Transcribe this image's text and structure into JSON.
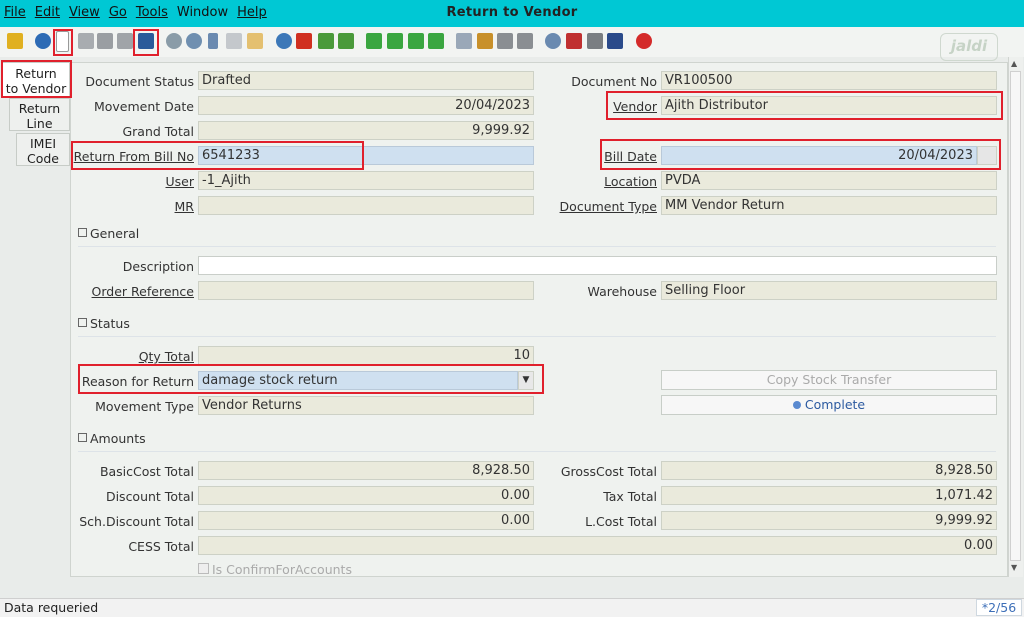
{
  "window": {
    "title": "Return to Vendor"
  },
  "menu": {
    "file": "File",
    "edit": "Edit",
    "view": "View",
    "go": "Go",
    "tools": "Tools",
    "window": "Window",
    "help": "Help"
  },
  "logo": "jaldi",
  "tabs": {
    "return_to_vendor_1": "Return",
    "return_to_vendor_2": "to Vendor",
    "return_line_1": "Return",
    "return_line_2": "Line",
    "imei_1": "IMEI",
    "imei_2": "Code"
  },
  "header": {
    "document_status_label": "Document Status",
    "document_status": "Drafted",
    "movement_date_label": "Movement Date",
    "movement_date": "20/04/2023",
    "grand_total_label": "Grand Total",
    "grand_total": "9,999.92",
    "return_from_bill_no_label": "Return From Bill No",
    "return_from_bill_no": "6541233",
    "user_label": "User",
    "user": "-1_Ajith",
    "mr_label": "MR",
    "mr": "",
    "document_no_label": "Document No",
    "document_no": "VR100500",
    "vendor_label": "Vendor",
    "vendor": "Ajith Distributor",
    "bill_date_label": "Bill Date",
    "bill_date": "20/04/2023",
    "location_label": "Location",
    "location": "PVDA",
    "document_type_label": "Document Type",
    "document_type": "MM Vendor Return"
  },
  "general": {
    "section_title": "General",
    "description_label": "Description",
    "description": "",
    "order_reference_label": "Order Reference",
    "order_reference": "",
    "warehouse_label": "Warehouse",
    "warehouse": "Selling Floor"
  },
  "status": {
    "section_title": "Status",
    "qty_total_label": "Qty Total",
    "qty_total": "10",
    "reason_label": "Reason for Return",
    "reason": "damage stock return",
    "movement_type_label": "Movement Type",
    "movement_type": "Vendor Returns",
    "copy_stock_transfer": "Copy Stock Transfer",
    "complete": "Complete"
  },
  "amounts": {
    "section_title": "Amounts",
    "basic_cost_total_label": "BasicCost Total",
    "basic_cost_total": "8,928.50",
    "discount_total_label": "Discount Total",
    "discount_total": "0.00",
    "sch_discount_total_label": "Sch.Discount Total",
    "sch_discount_total": "0.00",
    "cess_total_label": "CESS Total",
    "cess_total": "0.00",
    "gross_cost_total_label": "GrossCost Total",
    "gross_cost_total": "8,928.50",
    "tax_total_label": "Tax Total",
    "tax_total": "1,071.42",
    "l_cost_total_label": "L.Cost Total",
    "l_cost_total": "9,999.92",
    "is_confirm_label": "Is ConfirmForAccounts"
  },
  "statusbar": {
    "message": "Data requeried",
    "pager": "*2/56"
  }
}
